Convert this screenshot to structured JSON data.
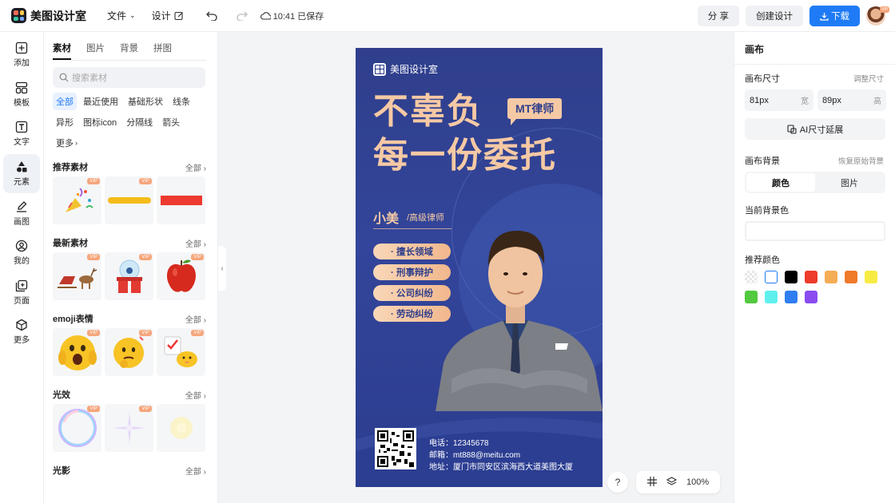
{
  "app": {
    "name": "美图设计室"
  },
  "topbar": {
    "file_menu": "文件",
    "design_menu": "设计",
    "save_status": "10:41 已保存",
    "share_label": "分 享",
    "create_label": "创建设计",
    "download_label": "下载",
    "avatar_badge": "VIP"
  },
  "rail": {
    "items": [
      {
        "label": "添加",
        "icon": "add-icon"
      },
      {
        "label": "模板",
        "icon": "template-icon"
      },
      {
        "label": "文字",
        "icon": "text-icon"
      },
      {
        "label": "元素",
        "icon": "element-icon",
        "active": true
      },
      {
        "label": "画图",
        "icon": "draw-icon"
      },
      {
        "label": "我的",
        "icon": "user-icon"
      },
      {
        "label": "页面",
        "icon": "page-icon"
      },
      {
        "label": "更多",
        "icon": "more-icon"
      }
    ]
  },
  "panel": {
    "tabs": [
      "素材",
      "图片",
      "背景",
      "拼图"
    ],
    "search_placeholder": "搜索素材",
    "filters": [
      "全部",
      "最近使用",
      "基础形状",
      "线条",
      "异形",
      "图标icon",
      "分隔线",
      "箭头",
      "更多"
    ],
    "all_label": "全部",
    "vip_label": "VIP",
    "sections": [
      {
        "title": "推荐素材"
      },
      {
        "title": "最新素材"
      },
      {
        "title": "emoji表情"
      },
      {
        "title": "光效"
      },
      {
        "title": "光影"
      }
    ]
  },
  "poster": {
    "brand": "美图设计室",
    "headline_1": "不辜负",
    "tag": "MT律师",
    "headline_2": "每一份委托",
    "name": "小美",
    "title": "/高级律师",
    "services": [
      "· 擅长领域",
      "· 刑事辩护",
      "· 公司纠纷",
      "· 劳动纠纷"
    ],
    "phone": "电话：12345678",
    "email": "邮箱：mt888@meitu.com",
    "address": "地址：厦门市同安区滨海西大道美图大厦"
  },
  "canvas_tools": {
    "help": "?",
    "zoom": "100%"
  },
  "right_panel": {
    "title": "画布",
    "size_label": "画布尺寸",
    "resize_link": "调整尺寸",
    "width_value": "81px",
    "width_unit": "宽",
    "height_value": "89px",
    "height_unit": "高",
    "ai_button": "AI尺寸延展",
    "bg_label": "画布背景",
    "restore_link": "恢复原始背景",
    "seg_color": "颜色",
    "seg_image": "图片",
    "current_bg_label": "当前背景色",
    "recommend_label": "推荐颜色",
    "swatches": [
      "transparent",
      "#ffffff",
      "#000000",
      "#ee3b2a",
      "#f4ad55",
      "#f07a2a",
      "#f7ec43",
      "#52c93f",
      "#5ff0ee",
      "#2f7df0",
      "#8a4cf0"
    ]
  }
}
